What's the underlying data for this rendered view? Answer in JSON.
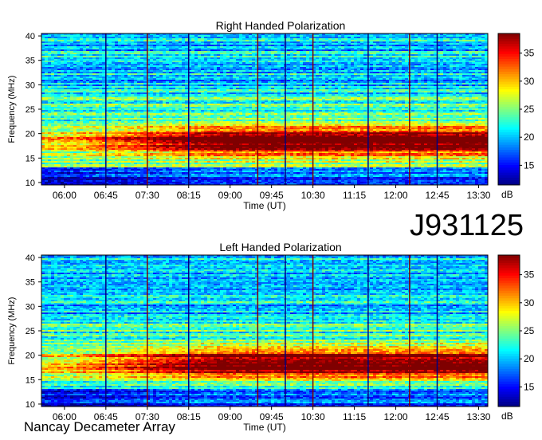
{
  "event_id": "J931125",
  "footer": "Nancay Decameter Array",
  "colors": {
    "colormap": [
      "#00007f",
      "#0000ff",
      "#007fff",
      "#00ffff",
      "#7fff7f",
      "#ffff00",
      "#ff7f00",
      "#ff0000",
      "#7f0000"
    ]
  },
  "chart_data": [
    {
      "type": "heatmap",
      "title": "Right Handed Polarization",
      "xlabel": "Time (UT)",
      "ylabel": "Frequency (MHz)",
      "x_ticks": [
        "06:00",
        "06:45",
        "07:30",
        "08:15",
        "09:00",
        "09:45",
        "10:30",
        "11:15",
        "12:00",
        "12:45",
        "13:30"
      ],
      "x_range": [
        "05:35",
        "13:40"
      ],
      "y_ticks": [
        10,
        15,
        20,
        25,
        30,
        35,
        40
      ],
      "ylim": [
        9.5,
        40.5
      ],
      "colorbar": {
        "label": "dB",
        "ticks": [
          15,
          20,
          25,
          30,
          35
        ],
        "range": [
          11.5,
          38.5
        ]
      },
      "vertical_lines": [
        "06:45",
        "07:30",
        "08:15",
        "09:30",
        "10:00",
        "10:30",
        "11:30",
        "12:15",
        "12:45"
      ]
    },
    {
      "type": "heatmap",
      "title": "Left Handed Polarization",
      "xlabel": "Time (UT)",
      "ylabel": "Frequency (MHz)",
      "x_ticks": [
        "06:00",
        "06:45",
        "07:30",
        "08:15",
        "09:00",
        "09:45",
        "10:30",
        "11:15",
        "12:00",
        "12:45",
        "13:30"
      ],
      "x_range": [
        "05:35",
        "13:40"
      ],
      "y_ticks": [
        10,
        15,
        20,
        25,
        30,
        35,
        40
      ],
      "ylim": [
        9.5,
        40.5
      ],
      "colorbar": {
        "label": "dB",
        "ticks": [
          15,
          20,
          25,
          30,
          35
        ],
        "range": [
          11.5,
          38.5
        ]
      },
      "vertical_lines": [
        "06:45",
        "07:30",
        "08:15",
        "09:30",
        "10:00",
        "10:30",
        "11:30",
        "12:15",
        "12:45"
      ]
    }
  ]
}
